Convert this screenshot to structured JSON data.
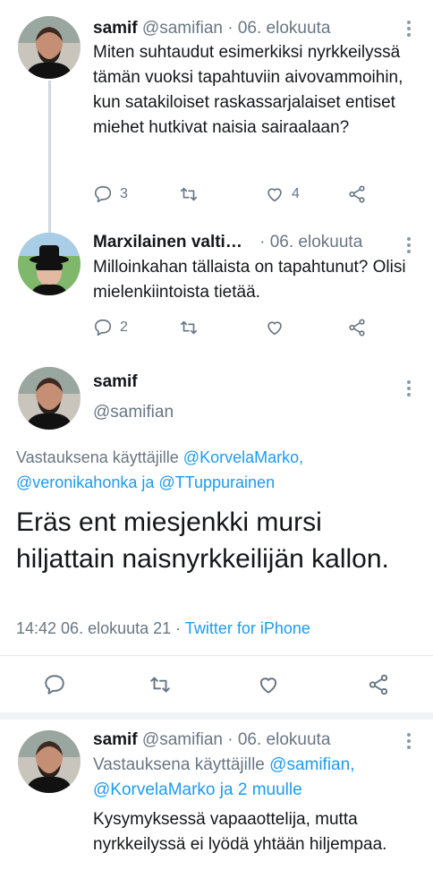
{
  "tweets": [
    {
      "name": "samif",
      "handle": "@samifian",
      "separator": "·",
      "date": "06. elokuuta",
      "text": "Miten suhtaudut esimerkiksi nyrkkeilyssä tämän vuoksi tapahtuviin aivovammoihin, kun satakiloiset raskassarjalaiset entiset miehet hutkivat naisia sairaalaan?",
      "replies": "3",
      "retweets": "",
      "likes": "4"
    },
    {
      "name": "Marxilainen valti…",
      "separator": "·",
      "date": "06. elokuuta",
      "text": "Milloinkahan tällaista on tapahtunut? Olisi mielenkiintoista tietää.",
      "replies": "2",
      "retweets": "",
      "likes": ""
    }
  ],
  "focused": {
    "name": "samif",
    "handle": "@samifian",
    "reply_prefix": "Vastauksena käyttäjille",
    "mention1": "@KorvelaMarko,",
    "mention2": "@veronikahonka",
    "reply_and": "ja",
    "mention3": "@TTuppurainen",
    "text": "Eräs ent miesjenkki mursi hiljattain naisnyrkkeilijän kallon.",
    "time": "14:42 06. elokuuta 21",
    "separator": "·",
    "source": "Twitter for iPhone"
  },
  "last_tweet": {
    "name": "samif",
    "handle": "@samifian",
    "separator": "·",
    "date": "06. elokuuta",
    "reply_prefix": "Vastauksena käyttäjille",
    "mention1": "@samifian,",
    "mention2": "@KorvelaMarko",
    "reply_rest": "ja 2 muulle",
    "text": "Kysymyksessä vapaaottelija, mutta nyrkkeilyssä ei lyödä yhtään hiljempaa."
  },
  "colors": {
    "accent": "#1d9bf0",
    "muted": "#687684",
    "text": "#14171a"
  },
  "icons": [
    "reply-icon",
    "retweet-icon",
    "like-icon",
    "share-icon",
    "more-icon"
  ]
}
